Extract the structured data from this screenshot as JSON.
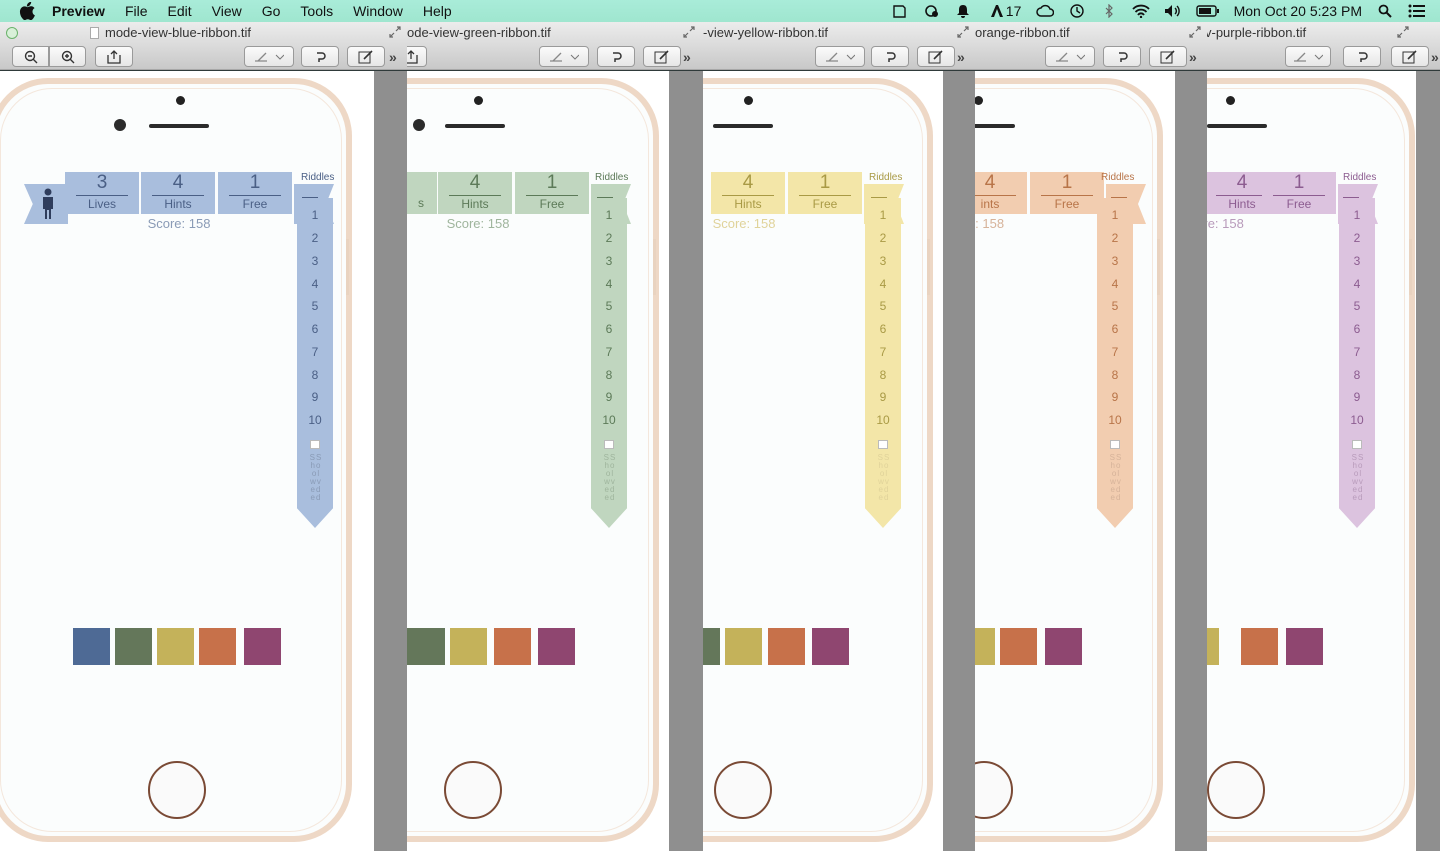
{
  "menubar": {
    "app": "Preview",
    "items": [
      "File",
      "Edit",
      "View",
      "Go",
      "Tools",
      "Window",
      "Help"
    ],
    "adobe_count": "17",
    "clock": "Mon Oct 20  5:23 PM"
  },
  "colors": {
    "blue": "#a9bedd",
    "blue_text": "#4a5f85",
    "green": "#c0d6bf",
    "green_text": "#5c7a58",
    "yellow": "#f3e6a8",
    "yellow_text": "#a99a45",
    "orange": "#f2cdb0",
    "orange_text": "#b87448",
    "purple": "#dcc3df",
    "purple_text": "#8c5c90",
    "swatches": [
      "#4e6a95",
      "#64775a",
      "#c4b25a",
      "#c7714a",
      "#8f4670"
    ]
  },
  "windows": [
    {
      "title": "mode-view-blue-ribbon.tif",
      "lives": "3",
      "lives_label": "Lives",
      "hints": "4",
      "hints_label": "Hints",
      "free": "1",
      "free_label": "Free",
      "score": "Score: 158"
    },
    {
      "title": "ode-view-green-ribbon.tif",
      "hints_partial": "s",
      "hints": "4",
      "hints_label": "Hints",
      "free": "1",
      "free_label": "Free",
      "score": "Score: 158"
    },
    {
      "title": "-view-yellow-ribbon.tif",
      "hints": "4",
      "hints_label": "Hints",
      "free": "1",
      "free_label": "Free",
      "score": "Score: 158"
    },
    {
      "title": "orange-ribbon.tif",
      "hints": "4",
      "hints_label": "ints",
      "free": "1",
      "free_label": "Free",
      "score": "e: 158"
    },
    {
      "title": "v-purple-ribbon.tif",
      "hints": "4",
      "hints_label": "Hints",
      "free": "1",
      "free_label": "Free",
      "score": "ore: 158"
    }
  ],
  "riddles": {
    "header": "Riddles",
    "numbers": [
      "1",
      "2",
      "3",
      "4",
      "5",
      "6",
      "7",
      "8",
      "9",
      "10"
    ],
    "show_solved": "SS ho ol wv ed ed"
  }
}
